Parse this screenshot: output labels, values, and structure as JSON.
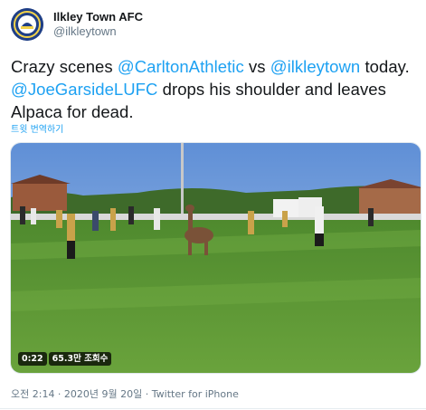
{
  "account": {
    "display_name": "Ilkley Town AFC",
    "handle": "@ilkleytown"
  },
  "tweet": {
    "t1": "Crazy scenes ",
    "m1": "@CarltonAthletic",
    "t2": " vs ",
    "m2": "@ilkleytown",
    "t3": " today. ",
    "m3": "@JoeGarsideLUFC",
    "t4": " drops his shoulder and leaves Alpaca for dead.",
    "translate_label": "트윗 번역하기"
  },
  "video": {
    "duration": "0:22",
    "views": "65.3만 조회수"
  },
  "meta": {
    "timestamp": "오전 2:14 · 2020년 9월 20일 · Twitter for iPhone"
  },
  "colors": {
    "link": "#1da1f2",
    "text": "#14171a",
    "muted": "#657786"
  }
}
